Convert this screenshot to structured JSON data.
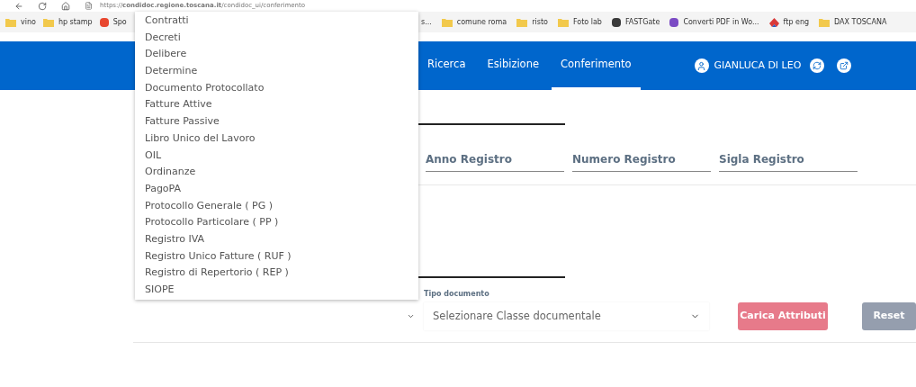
{
  "browser": {
    "url": "https://**condidoc.regione.toscana.it**/condidoc_ui/conferimento"
  },
  "bookmarks_left": [
    {
      "label": "vino",
      "kind": "folder"
    },
    {
      "label": "hp stamp",
      "kind": "folder"
    },
    {
      "label": "Spo",
      "kind": "red-tile"
    }
  ],
  "bookmarks_right": [
    {
      "label": "s...",
      "kind": "none"
    },
    {
      "label": "comune roma",
      "kind": "folder"
    },
    {
      "label": "risto",
      "kind": "folder"
    },
    {
      "label": "Foto lab",
      "kind": "folder"
    },
    {
      "label": "FASTGate",
      "kind": "dark-tile"
    },
    {
      "label": "Converti PDF in Wo...",
      "kind": "pdf-tile"
    },
    {
      "label": "ftp eng",
      "kind": "logo"
    },
    {
      "label": "DAX TOSCANA",
      "kind": "folder"
    }
  ],
  "nav": {
    "tabs": [
      {
        "label": "Ricerca",
        "selected": false
      },
      {
        "label": "Esibizione",
        "selected": false
      },
      {
        "label": "Conferimento",
        "selected": true
      }
    ],
    "user": "GIANLUCA DI LEO"
  },
  "registry_fields": [
    {
      "placeholder": "Anno Registro"
    },
    {
      "placeholder": "Numero Registro"
    },
    {
      "placeholder": "Sigla Registro"
    }
  ],
  "document_type": {
    "label": "Tipo documento",
    "placeholder": "Selezionare Classe documentale"
  },
  "buttons": [
    {
      "label": "Carica Attributi",
      "kind": "primary",
      "disabled": true
    },
    {
      "label": "Reset",
      "kind": "secondary",
      "disabled": true
    }
  ],
  "dropdown_options": [
    "Contratti",
    "Decreti",
    "Delibere",
    "Determine",
    "Documento Protocollato",
    "Fatture Attive",
    "Fatture Passive",
    "Libro Unico del Lavoro",
    "OIL",
    "Ordinanze",
    "PagoPA",
    "Protocollo Generale ( PG )",
    "Protocollo Particolare ( PP )",
    "Registro IVA",
    "Registro Unico Fatture ( RUF )",
    "Registro di Repertorio ( REP )",
    "SIOPE"
  ]
}
